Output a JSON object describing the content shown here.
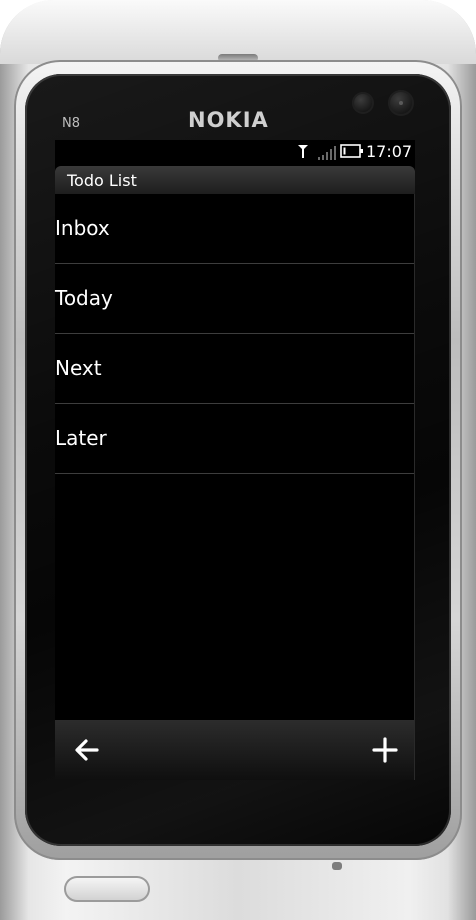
{
  "device": {
    "brand": "NOKIA",
    "model": "N8"
  },
  "status_bar": {
    "time": "17:07",
    "icons": [
      "antenna-icon",
      "signal-strength-icon",
      "battery-icon"
    ]
  },
  "app": {
    "title": "Todo List"
  },
  "list": {
    "items": [
      {
        "label": "Inbox"
      },
      {
        "label": "Today"
      },
      {
        "label": "Next"
      },
      {
        "label": "Later"
      }
    ]
  },
  "toolbar": {
    "back_icon": "back-arrow-icon",
    "add_icon": "plus-icon"
  },
  "colors": {
    "screen_background": "#000000",
    "text": "#ffffff",
    "divider": "#3d3d3d",
    "title_bar": "#2a2a2a"
  }
}
